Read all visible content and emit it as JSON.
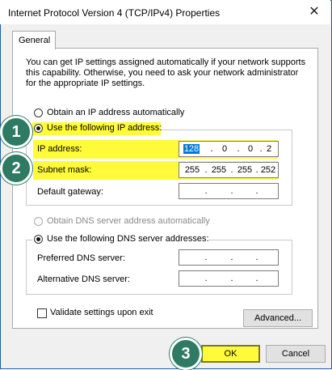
{
  "window": {
    "title": "Internet Protocol Version 4 (TCP/IPv4) Properties",
    "close_glyph": "✕"
  },
  "tabs": [
    {
      "label": "General",
      "selected": true
    }
  ],
  "description": "You can get IP settings assigned automatically if your network supports this capability. Otherwise, you need to ask your network administrator for the appropriate IP settings.",
  "ip_mode": {
    "auto_label": "Obtain an IP address automatically",
    "manual_label": "Use the following IP address:",
    "selected": "manual"
  },
  "ip_fields": {
    "ip_address": {
      "label": "IP address:",
      "octets": [
        "128",
        "0",
        "0",
        "2"
      ]
    },
    "subnet_mask": {
      "label": "Subnet mask:",
      "octets": [
        "255",
        "255",
        "255",
        "252"
      ]
    },
    "default_gateway": {
      "label": "Default gateway:",
      "octets": [
        "",
        "",
        "",
        ""
      ]
    }
  },
  "dns_mode": {
    "auto_label": "Obtain DNS server address automatically",
    "manual_label": "Use the following DNS server addresses:",
    "selected": "manual"
  },
  "dns_fields": {
    "preferred": {
      "label": "Preferred DNS server:",
      "octets": [
        "",
        "",
        "",
        ""
      ]
    },
    "alternative": {
      "label": "Alternative DNS server:",
      "octets": [
        "",
        "",
        "",
        ""
      ]
    }
  },
  "validate": {
    "label": "Validate settings upon exit",
    "checked": false
  },
  "buttons": {
    "advanced": "Advanced...",
    "ok": "OK",
    "cancel": "Cancel"
  },
  "callouts": [
    "1",
    "2",
    "3"
  ],
  "colors": {
    "highlight": "#fffb3a",
    "callout": "#2f7a63",
    "selection": "#0078d7"
  }
}
